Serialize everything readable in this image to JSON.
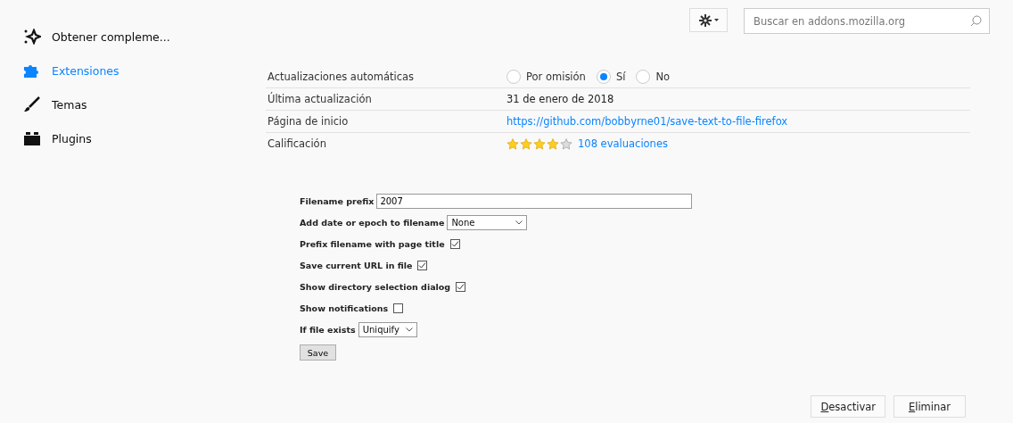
{
  "sidebar": {
    "items": [
      {
        "label": "Obtener compleme...",
        "kind": "discover",
        "selected": false
      },
      {
        "label": "Extensiones",
        "kind": "extensions",
        "selected": true
      },
      {
        "label": "Temas",
        "kind": "themes",
        "selected": false
      },
      {
        "label": "Plugins",
        "kind": "plugins",
        "selected": false
      }
    ]
  },
  "toolbar": {
    "search": {
      "placeholder": "Buscar en addons.mozilla.org"
    }
  },
  "details": [
    {
      "label": "Actualizaciones automáticas",
      "kind": "radios",
      "options": [
        {
          "label": "Por omisión",
          "selected": false
        },
        {
          "label": "Sí",
          "selected": true
        },
        {
          "label": "No",
          "selected": false
        }
      ]
    },
    {
      "label": "Última actualización",
      "kind": "text",
      "value": "31 de enero de 2018"
    },
    {
      "label": "Página de inicio",
      "kind": "link",
      "value": "https://github.com/bobbyrne01/save-text-to-file-firefox"
    },
    {
      "label": "Calificación",
      "kind": "rating",
      "stars": 4,
      "value": "108 evaluaciones"
    }
  ],
  "options": [
    {
      "label": "Filename prefix",
      "kind": "text",
      "value": "2007"
    },
    {
      "label": "Add date or epoch to filename",
      "kind": "select",
      "value": "None"
    },
    {
      "label": "Prefix filename with page title",
      "kind": "checkbox",
      "checked": true
    },
    {
      "label": "Save current URL in file",
      "kind": "checkbox",
      "checked": true
    },
    {
      "label": "Show directory selection dialog",
      "kind": "checkbox",
      "checked": true
    },
    {
      "label": "Show notifications",
      "kind": "checkbox",
      "checked": false
    },
    {
      "label": "If file exists",
      "kind": "select",
      "value": "Uniquify"
    }
  ],
  "save_button": "Save",
  "buttons": [
    {
      "label": "Desactivar",
      "underlined_first": true
    },
    {
      "label": "Eliminar",
      "underlined_first": true
    }
  ]
}
